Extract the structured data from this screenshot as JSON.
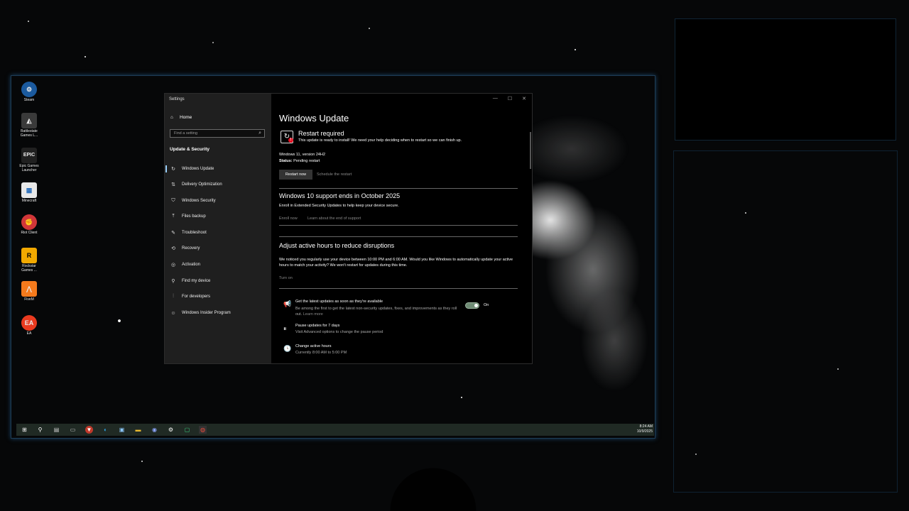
{
  "desktop": {
    "icons": [
      {
        "label": "Steam",
        "icon": "steam-icon",
        "color": "#1b5a9e"
      },
      {
        "label": "Battlestate Games L...",
        "icon": "battlestate-icon",
        "color": "#3a3a3a"
      },
      {
        "label": "Epic Games Launcher",
        "icon": "epic-games-icon",
        "color": "#202020"
      },
      {
        "label": "Minecraft",
        "icon": "minecraft-icon",
        "color": "#e8e8e8"
      },
      {
        "label": "Riot Client",
        "icon": "riot-client-icon",
        "color": "#d13639"
      },
      {
        "label": "Rockstar Games ...",
        "icon": "rockstar-icon",
        "color": "#f2a900"
      },
      {
        "label": "FiveM",
        "icon": "fivem-icon",
        "color": "#f57a1c"
      },
      {
        "label": "EA",
        "icon": "ea-icon",
        "color": "#ea3a1f"
      }
    ]
  },
  "settings": {
    "window_title": "Settings",
    "home_label": "Home",
    "search_placeholder": "Find a setting",
    "section_title": "Update & Security",
    "nav": [
      {
        "label": "Windows Update",
        "icon": "refresh-icon",
        "active": true
      },
      {
        "label": "Delivery Optimization",
        "icon": "delivery-icon"
      },
      {
        "label": "Windows Security",
        "icon": "shield-icon"
      },
      {
        "label": "Files backup",
        "icon": "backup-icon"
      },
      {
        "label": "Troubleshoot",
        "icon": "wrench-icon"
      },
      {
        "label": "Recovery",
        "icon": "recovery-icon"
      },
      {
        "label": "Activation",
        "icon": "activation-icon"
      },
      {
        "label": "Find my device",
        "icon": "person-location-icon"
      },
      {
        "label": "For developers",
        "icon": "developer-icon"
      },
      {
        "label": "Windows Insider Program",
        "icon": "insider-icon"
      }
    ],
    "main": {
      "title": "Windows Update",
      "restart_heading": "Restart required",
      "restart_desc": "This update is ready to install! We need your help deciding when to restart so we can finish up.",
      "version": "Windows 11, version 24H2",
      "status_label": "Status:",
      "status_value": "Pending restart",
      "restart_now": "Restart now",
      "schedule_restart": "Schedule the restart",
      "support_heading": "Windows 10 support ends in October 2025",
      "support_desc": "Enroll in Extended Security Updates to help keep your device secure.",
      "enroll_now": "Enroll now",
      "learn_end": "Learn about the end of support",
      "active_heading": "Adjust active hours to reduce disruptions",
      "active_desc": "We noticed you regularly use your device between 10:00 PM and 6:00 AM. Would you like Windows to automatically update your active hours to match your activity? We won't restart for updates during this time.",
      "turn_on": "Turn on",
      "latest_title": "Get the latest updates as soon as they're available",
      "latest_desc": "Be among the first to get the latest non-security updates, fixes, and improvements as they roll out.",
      "learn_more": "Learn more",
      "toggle_state": "On",
      "toggle_on": true,
      "pause_title": "Pause updates for 7 days",
      "pause_desc": "Visit Advanced options to change the pause period",
      "change_title": "Change active hours",
      "change_desc": "Currently 8:00 AM to 5:00 PM"
    }
  },
  "taskbar": {
    "time": "8:24 AM",
    "date": "10/9/2025"
  }
}
